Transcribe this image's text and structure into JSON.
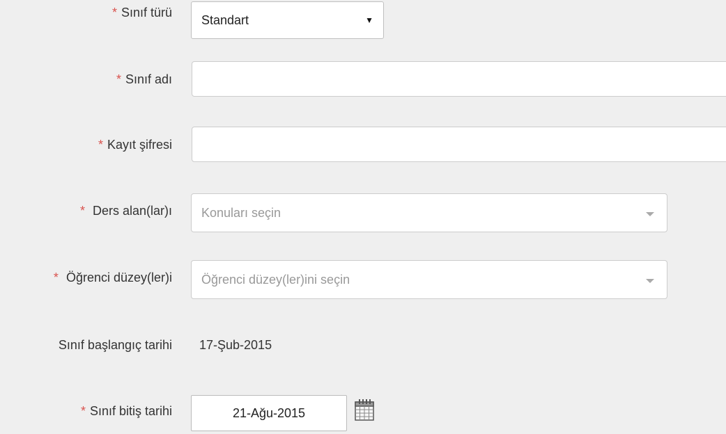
{
  "required_mark": "*",
  "fields": {
    "class_type": {
      "label": "Sınıf türü",
      "value": "Standart",
      "arrow": "▼"
    },
    "class_name": {
      "label": "Sınıf adı",
      "value": ""
    },
    "enroll_password": {
      "label": "Kayıt şifresi",
      "value": ""
    },
    "subjects": {
      "label": "Ders alan(lar)ı",
      "placeholder": "Konuları seçin"
    },
    "levels": {
      "label": "Öğrenci düzey(ler)i",
      "placeholder": "Öğrenci düzey(ler)ini seçin"
    },
    "start_date": {
      "label": "Sınıf başlangıç tarihi",
      "value": "17-Şub-2015"
    },
    "end_date": {
      "label": "Sınıf bitiş tarihi",
      "value": "21-Ağu-2015"
    }
  },
  "icons": {
    "calendar": "calendar-icon"
  },
  "colors": {
    "required": "#d9534f",
    "background": "#efefef",
    "placeholder": "#999999"
  }
}
